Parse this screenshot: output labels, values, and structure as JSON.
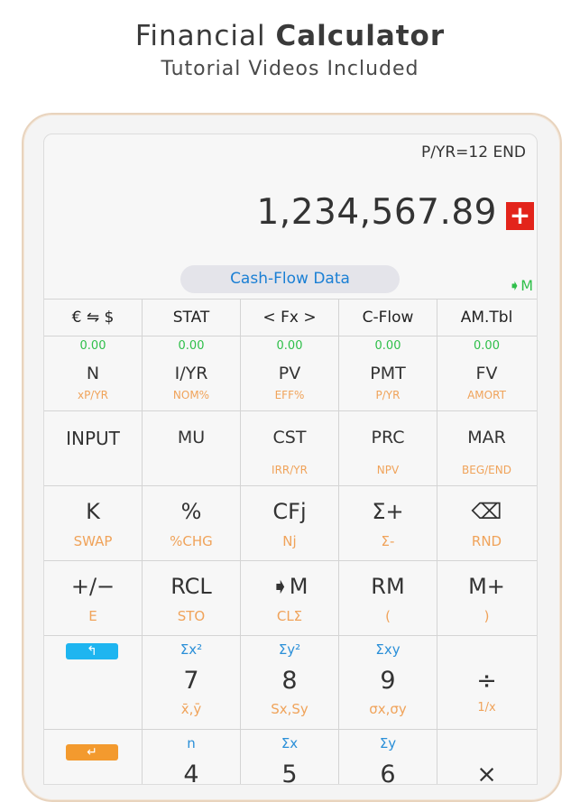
{
  "header": {
    "title_regular": "Financial",
    "title_bold": "Calculator",
    "subtitle": "Tutorial Videos Included"
  },
  "calc": {
    "status": "P/YR=12 END",
    "display": "1,234,567.89",
    "plus_badge": "+",
    "pill": "Cash-Flow Data",
    "mem_indicator": "➧M",
    "top_row": [
      "€ ⇋ $",
      "STAT",
      "< Fx >",
      "C-Flow",
      "AM.Tbl"
    ],
    "tvm_row": [
      {
        "g": "0.00",
        "b": "N",
        "o": "xP/YR"
      },
      {
        "g": "0.00",
        "b": "I/YR",
        "o": "NOM%"
      },
      {
        "g": "0.00",
        "b": "PV",
        "o": "EFF%"
      },
      {
        "g": "0.00",
        "b": "PMT",
        "o": "P/YR"
      },
      {
        "g": "0.00",
        "b": "FV",
        "o": "AMORT"
      }
    ],
    "row3": [
      {
        "b": "INPUT",
        "o": ""
      },
      {
        "b": "MU",
        "o": ""
      },
      {
        "b": "CST",
        "o": "IRR/YR"
      },
      {
        "b": "PRC",
        "o": "NPV"
      },
      {
        "b": "MAR",
        "o": "BEG/END"
      }
    ],
    "row4": [
      {
        "b": "K",
        "o": "SWAP"
      },
      {
        "b": "%",
        "o": "%CHG"
      },
      {
        "b": "CFj",
        "o": "Nj"
      },
      {
        "b": "Σ+",
        "o": "Σ-"
      },
      {
        "b": "⌫",
        "o": "RND"
      }
    ],
    "row5": [
      {
        "b": "+/−",
        "o": "E"
      },
      {
        "b": "RCL",
        "o": "STO"
      },
      {
        "b": "➧M",
        "o": "CLΣ"
      },
      {
        "b": "RM",
        "o": "("
      },
      {
        "b": "M+",
        "o": ")"
      }
    ],
    "row6": {
      "shift_key": "↰",
      "cells": [
        {
          "t": "Σx²",
          "b": "7",
          "o": "x̄,ȳ"
        },
        {
          "t": "Σy²",
          "b": "8",
          "o": "Sx,Sy"
        },
        {
          "t": "Σxy",
          "b": "9",
          "o": "σx,σy"
        },
        {
          "t": "",
          "b": "÷",
          "o": "1/x"
        }
      ]
    },
    "row7": {
      "enter_key": "↵",
      "cells": [
        {
          "t": "n",
          "b": "4"
        },
        {
          "t": "Σx",
          "b": "5"
        },
        {
          "t": "Σy",
          "b": "6"
        },
        {
          "t": "",
          "b": "×"
        }
      ]
    }
  }
}
